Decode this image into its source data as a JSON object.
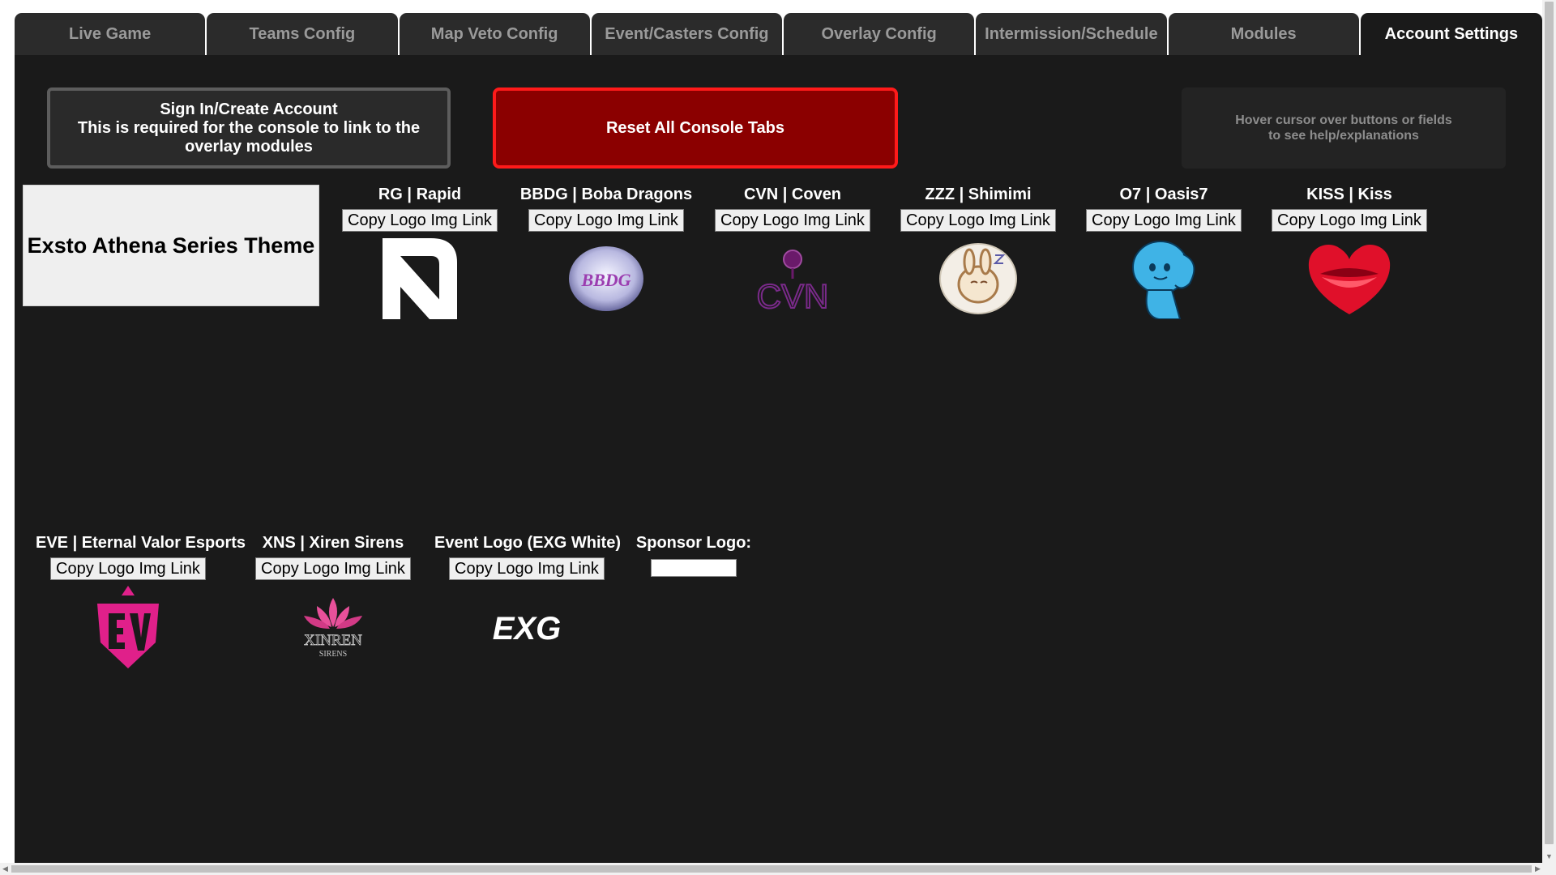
{
  "tabs": [
    {
      "label": "Live Game",
      "active": false
    },
    {
      "label": "Teams Config",
      "active": false
    },
    {
      "label": "Map Veto Config",
      "active": false
    },
    {
      "label": "Event/Casters Config",
      "active": false
    },
    {
      "label": "Overlay Config",
      "active": false
    },
    {
      "label": "Intermission/Schedule",
      "active": false
    },
    {
      "label": "Modules",
      "active": false
    },
    {
      "label": "Account Settings",
      "active": true
    }
  ],
  "signin": {
    "line1": "Sign In/Create Account",
    "line2": "This is required for the console to link to the",
    "line3": "overlay modules"
  },
  "reset_label": "Reset All Console Tabs",
  "help": {
    "line1": "Hover cursor over buttons or fields",
    "line2": "to see help/explanations"
  },
  "theme_label": "Exsto Athena Series Theme",
  "copy_label": "Copy Logo Img Link",
  "teams": [
    {
      "name": "RG | Rapid",
      "logo": "rapid-logo"
    },
    {
      "name": "BBDG | Boba Dragons",
      "logo": "boba-dragons-logo"
    },
    {
      "name": "CVN | Coven",
      "logo": "coven-logo"
    },
    {
      "name": "ZZZ | Shimimi",
      "logo": "shimimi-logo"
    },
    {
      "name": "O7 | Oasis7",
      "logo": "oasis7-logo"
    },
    {
      "name": "KISS | Kiss",
      "logo": "kiss-logo"
    },
    {
      "name": "EVE | Eternal Valor Esports",
      "logo": "eternal-valor-logo"
    },
    {
      "name": "XNS | Xiren Sirens",
      "logo": "xiren-sirens-logo"
    },
    {
      "name": "Event Logo (EXG White)",
      "logo": "exg-logo"
    }
  ],
  "sponsor_label": "Sponsor Logo:",
  "logo_text": {
    "bbdg": "BBDG",
    "cvn": "CVN",
    "xinren": "XINREN",
    "sirens": "SIRENS",
    "exg": "EXG"
  },
  "colors": {
    "background": "#1a1a1a",
    "tab": "#2b2b2b",
    "reset_bg": "#8b0000",
    "reset_border": "#ff1a1a"
  }
}
